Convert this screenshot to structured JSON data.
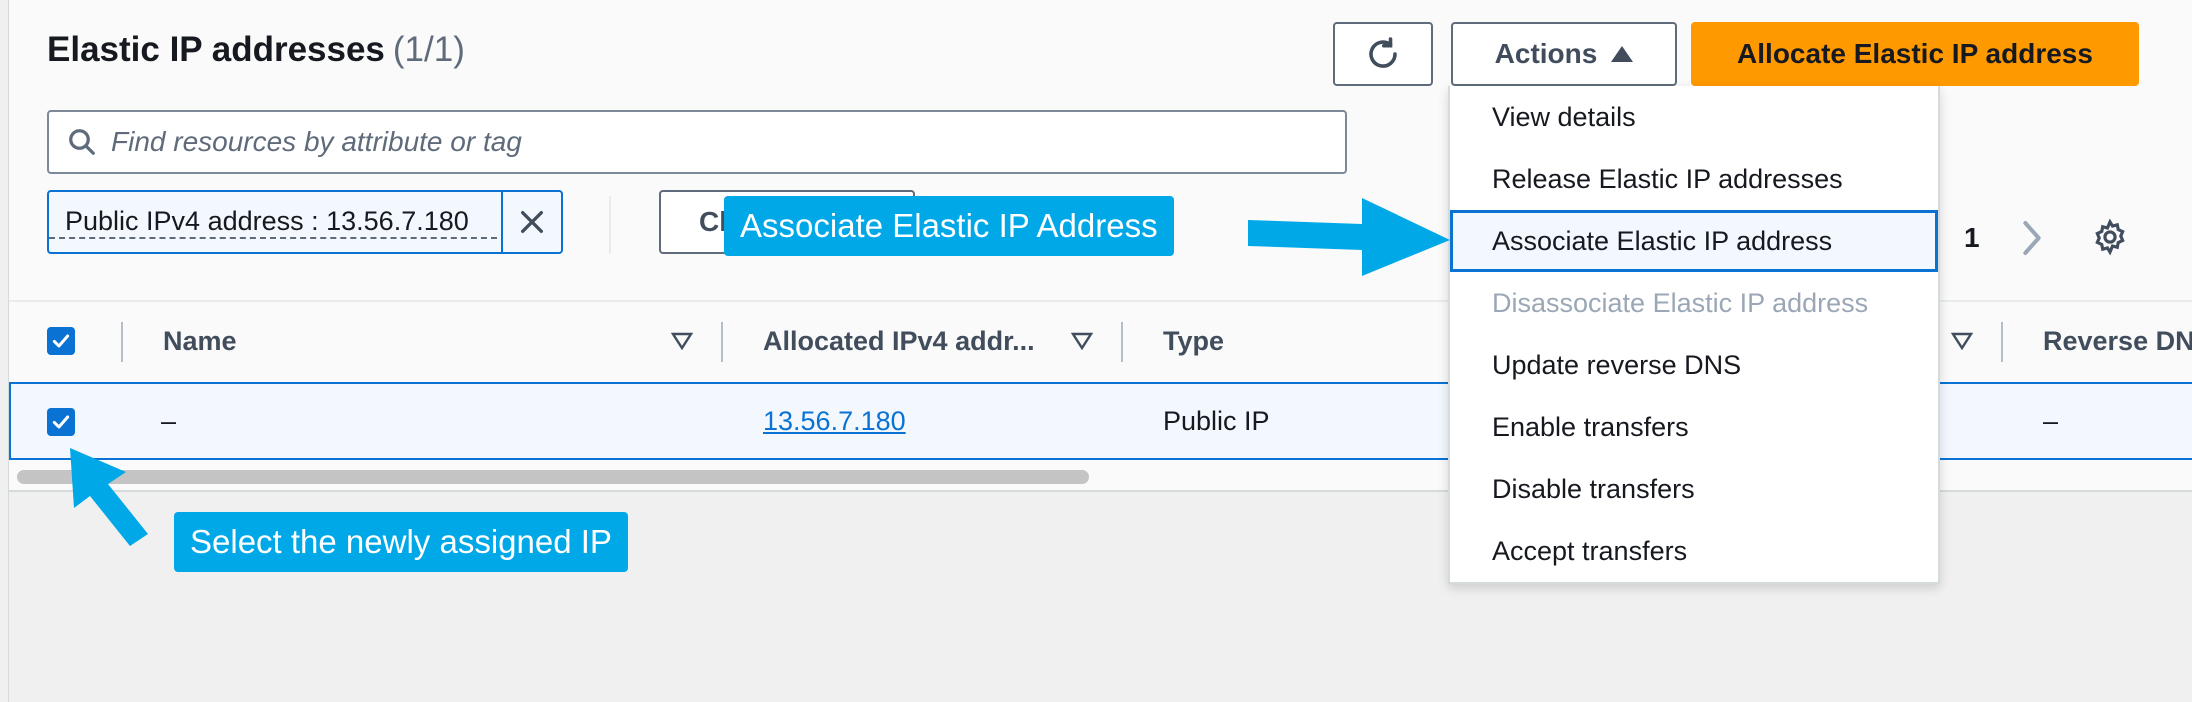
{
  "header": {
    "title": "Elastic IP addresses",
    "count": "(1/1)",
    "actions_label": "Actions",
    "allocate_label": "Allocate Elastic IP address"
  },
  "search": {
    "placeholder": "Find resources by attribute or tag"
  },
  "filter": {
    "token": "Public IPv4 address : 13.56.7.180",
    "clear_label_visible": "Cl"
  },
  "pagination": {
    "current_page": "1"
  },
  "table": {
    "columns": [
      "Name",
      "Allocated IPv4 addr...",
      "Type",
      "Reverse DN"
    ],
    "rows": [
      {
        "name": "–",
        "ip": "13.56.7.180",
        "type": "Public IP",
        "reverse_dns": "–"
      }
    ]
  },
  "actions_menu": {
    "items": [
      {
        "label": "View details",
        "state": "enabled"
      },
      {
        "label": "Release Elastic IP addresses",
        "state": "enabled"
      },
      {
        "label": "Associate Elastic IP address",
        "state": "highlighted"
      },
      {
        "label": "Disassociate Elastic IP address",
        "state": "disabled"
      },
      {
        "label": "Update reverse DNS",
        "state": "enabled"
      },
      {
        "label": "Enable transfers",
        "state": "enabled"
      },
      {
        "label": "Disable transfers",
        "state": "enabled"
      },
      {
        "label": "Accept transfers",
        "state": "enabled"
      }
    ]
  },
  "annotations": {
    "callout_associate": "Associate Elastic IP Address",
    "callout_select": "Select the newly assigned IP"
  },
  "colors": {
    "primary_orange": "#ff9900",
    "link_blue": "#0972d3",
    "callout_blue": "#00a8e8",
    "disabled_gray": "#9ba7b6"
  },
  "icons": {
    "refresh": "refresh-icon",
    "actions_caret": "caret-up-icon",
    "search": "search-icon",
    "token_remove": "close-icon",
    "next_page": "chevron-right-icon",
    "settings": "gear-icon",
    "sort": "sort-down-icon",
    "checkbox": "checkmark-icon"
  }
}
